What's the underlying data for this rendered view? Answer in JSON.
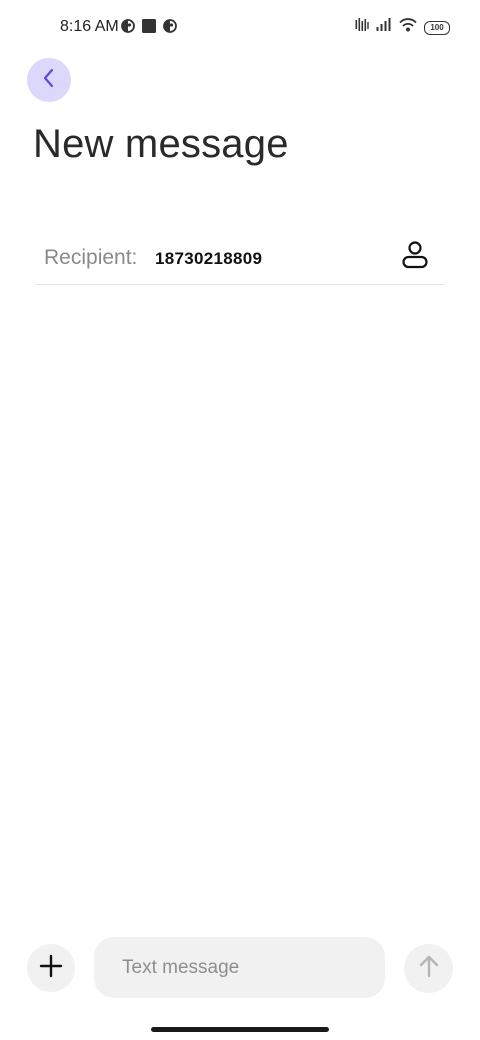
{
  "status_bar": {
    "time": "8:16 AM",
    "battery": "100",
    "left_icons": [
      "data-saver-icon",
      "square-notification-icon",
      "data-saver-icon"
    ],
    "right_icons": [
      "vibrate-signal-icon",
      "cellular-signal-icon",
      "wifi-icon",
      "battery-icon"
    ]
  },
  "header": {
    "back_icon": "chevron-left-icon",
    "title": "New message"
  },
  "recipient": {
    "label": "Recipient:",
    "value": "18730218809",
    "contact_icon": "person-icon"
  },
  "compose": {
    "attach_icon": "plus-icon",
    "placeholder": "Text message",
    "value": "",
    "send_icon": "arrow-up-icon"
  },
  "colors": {
    "accent": "#5a4be0",
    "back_button_bg": "#dcd8fb",
    "input_bg": "#f1f1f1",
    "label_gray": "#8a8a8a"
  }
}
